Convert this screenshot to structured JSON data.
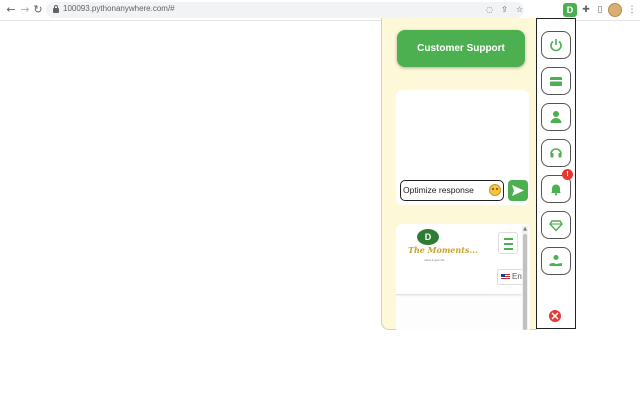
{
  "browser": {
    "url": "100093.pythonanywhere.com/#",
    "icons": [
      "back-icon",
      "forward-icon",
      "reload-icon",
      "lock-icon",
      "eye-off-icon",
      "share-icon",
      "star-icon",
      "extension-active-icon",
      "puzzle-icon",
      "sidepanel-icon",
      "profile-avatar",
      "more-icon"
    ]
  },
  "panel": {
    "customer_support_label": "Customer Support",
    "chat_input_value": "Optimize response",
    "website": {
      "logo_mark": "D",
      "logo_text": "The Moments...",
      "logo_sub": "nature & green life",
      "language": "En"
    }
  },
  "sidebar": {
    "items": [
      {
        "name": "power-icon"
      },
      {
        "name": "card-icon"
      },
      {
        "name": "user-icon"
      },
      {
        "name": "headset-icon"
      },
      {
        "name": "bell-icon",
        "badge": "!"
      },
      {
        "name": "diamond-icon"
      },
      {
        "name": "hand-user-icon"
      }
    ],
    "close": "close-icon"
  },
  "colors": {
    "accent": "#4caf50",
    "panel_bg": "#fdf8d8",
    "badge": "#e53935"
  }
}
